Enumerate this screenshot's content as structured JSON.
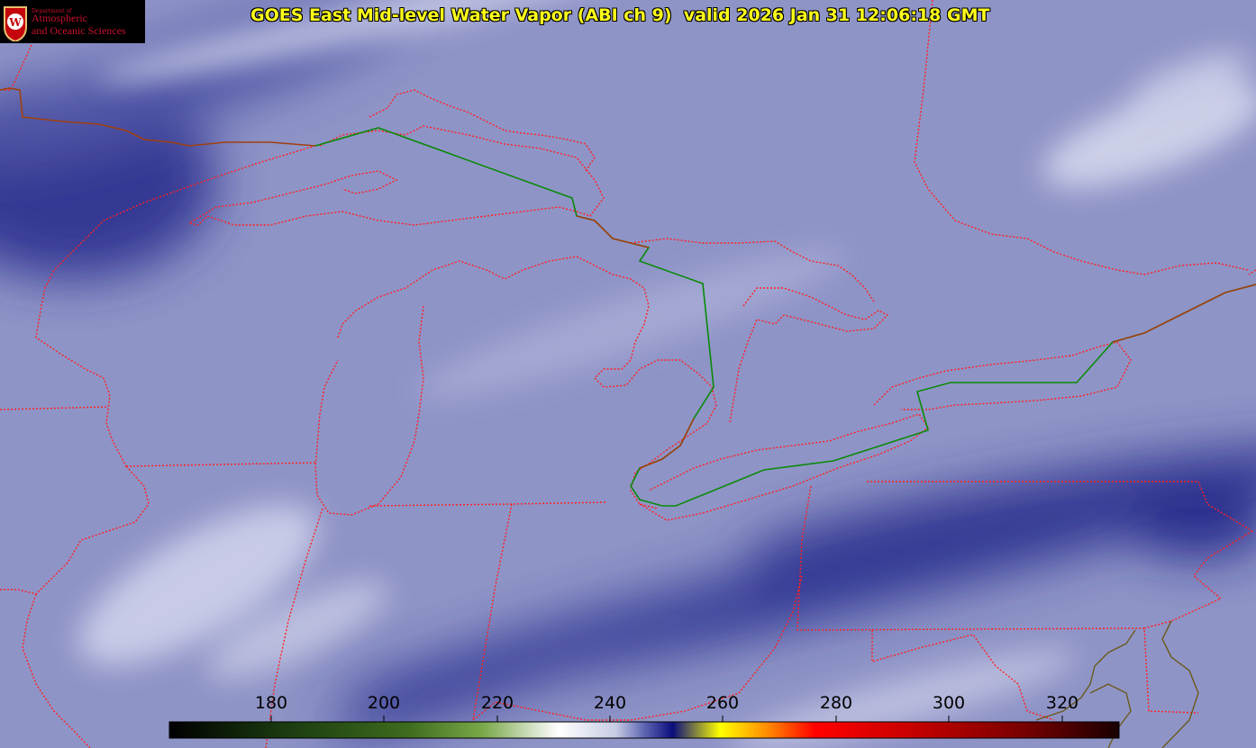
{
  "title": "GOES East Mid-level Water Vapor (ABI ch 9)  valid 2026 Jan 31 12:06:18 GMT",
  "logo": {
    "dept": "Department of",
    "line1": "Atmospheric",
    "line2": "and Oceanic Sciences",
    "seal_letter": "W"
  },
  "colorbar": {
    "ticks": [
      "180",
      "200",
      "220",
      "240",
      "260",
      "280",
      "300",
      "320"
    ],
    "min": 162,
    "max": 331,
    "gradient": [
      "#000000",
      "#1a3a10",
      "#3d6b1e",
      "#79a848",
      "#dfe9d6",
      "#ffffff",
      "#c7cbe4",
      "#5e66b3",
      "#0b0e7d",
      "#ffff00",
      "#ff8a00",
      "#ff0000",
      "#c80000",
      "#780000",
      "#1a0000"
    ]
  },
  "colors": {
    "background": "#8d93c6",
    "state_border": "#ff2020",
    "intl_border": "#0a8a0a",
    "title_text": "#ffff1a"
  }
}
